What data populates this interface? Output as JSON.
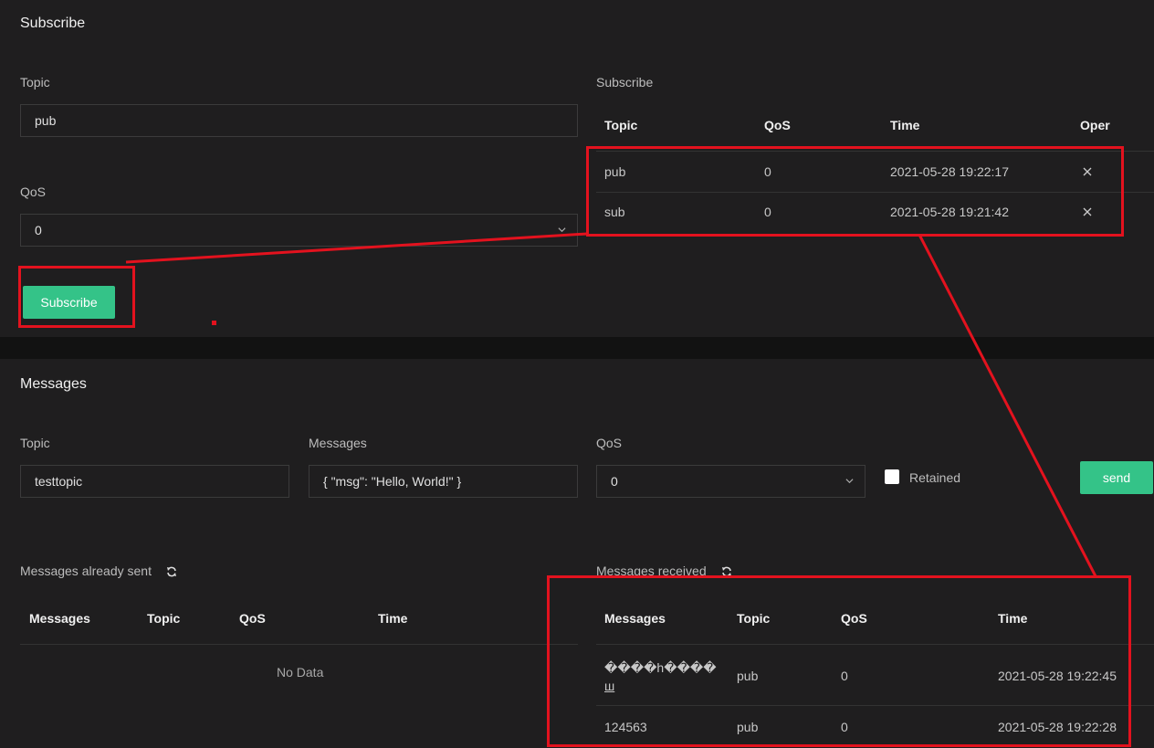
{
  "subscribe": {
    "title": "Subscribe",
    "topic_label": "Topic",
    "topic_value": "pub",
    "qos_label": "QoS",
    "qos_value": "0",
    "button_label": "Subscribe",
    "list_label": "Subscribe",
    "columns": [
      "Topic",
      "QoS",
      "Time",
      "Oper"
    ],
    "rows": [
      {
        "topic": "pub",
        "qos": "0",
        "time": "2021-05-28 19:22:17"
      },
      {
        "topic": "sub",
        "qos": "0",
        "time": "2021-05-28 19:21:42"
      }
    ]
  },
  "messages": {
    "title": "Messages",
    "topic_label": "Topic",
    "topic_value": "testtopic",
    "messages_label": "Messages",
    "messages_value": "{ \"msg\": \"Hello, World!\" }",
    "qos_label": "QoS",
    "qos_value": "0",
    "retained_label": "Retained",
    "send_label": "send",
    "sent": {
      "label": "Messages already sent",
      "columns": [
        "Messages",
        "Topic",
        "QoS",
        "Time"
      ],
      "empty_text": "No Data"
    },
    "received": {
      "label": "Messages received",
      "columns": [
        "Messages",
        "Topic",
        "QoS",
        "Time"
      ],
      "rows": [
        {
          "message": "����h����",
          "message_line2": "ш",
          "topic": "pub",
          "qos": "0",
          "time": "2021-05-28 19:22:45"
        },
        {
          "message": "124563",
          "message_line2": "",
          "topic": "pub",
          "qos": "0",
          "time": "2021-05-28 19:22:28"
        }
      ]
    }
  },
  "colors": {
    "accent": "#34c388",
    "annotation": "#e3121e",
    "panel": "#1f1e1f",
    "background": "#121212"
  }
}
